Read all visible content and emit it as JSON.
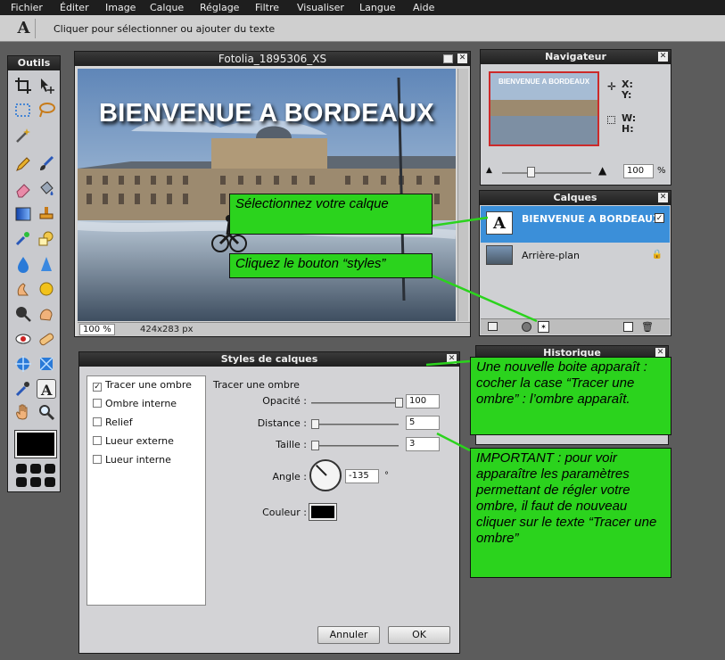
{
  "menubar": {
    "items": [
      "Fichier",
      "Éditer",
      "Image",
      "Calque",
      "Réglage",
      "Filtre",
      "Visualiser",
      "Langue",
      "Aide"
    ]
  },
  "toolbar": {
    "tool_glyph": "A",
    "hint": "Cliquer pour sélectionner ou ajouter du texte"
  },
  "tools_panel": {
    "title": "Outils"
  },
  "image_window": {
    "title": "Fotolia_1895306_XS",
    "headline": "BIENVENUE A BORDEAUX",
    "zoom": "100 %",
    "size": "424x283 px"
  },
  "navigator": {
    "title": "Navigateur",
    "x_label": "X:",
    "y_label": "Y:",
    "w_label": "W:",
    "h_label": "H:",
    "zoom_value": "100",
    "zoom_unit": "%"
  },
  "layers": {
    "title": "Calques",
    "items": [
      {
        "name": "BIENVENUE A BORDEAUX",
        "thumb": "A"
      },
      {
        "name": "Arrière-plan"
      }
    ]
  },
  "history": {
    "title": "Historique"
  },
  "styles_dialog": {
    "title": "Styles de calques",
    "styles": [
      {
        "label": "Tracer une ombre",
        "checked": true
      },
      {
        "label": "Ombre interne",
        "checked": false
      },
      {
        "label": "Relief",
        "checked": false
      },
      {
        "label": "Lueur externe",
        "checked": false
      },
      {
        "label": "Lueur interne",
        "checked": false
      }
    ],
    "section_title": "Tracer une ombre",
    "opacity_label": "Opacité :",
    "opacity_value": "100",
    "distance_label": "Distance :",
    "distance_value": "5",
    "size_label": "Taille :",
    "size_value": "3",
    "angle_label": "Angle :",
    "angle_value": "-135",
    "angle_unit": "°",
    "color_label": "Couleur :",
    "color_value": "#000000",
    "cancel_label": "Annuler",
    "ok_label": "OK"
  },
  "callouts": {
    "select_layer": "Sélectionnez votre calque",
    "styles_button": "Cliquez le bouton “styles”",
    "new_box": "Une nouvelle boite apparaît : cocher la case “Tracer une ombre” : l’ombre apparaît.",
    "important": "IMPORTANT : pour voir apparaître les paramètres permettant de régler votre ombre, il faut de nouveau cliquer sur le texte “Tracer une ombre”"
  },
  "colors": {
    "callout_green": "#2bd31d",
    "layer_selected": "#3b8fd9",
    "navigator_frame": "#cc2a2a"
  }
}
